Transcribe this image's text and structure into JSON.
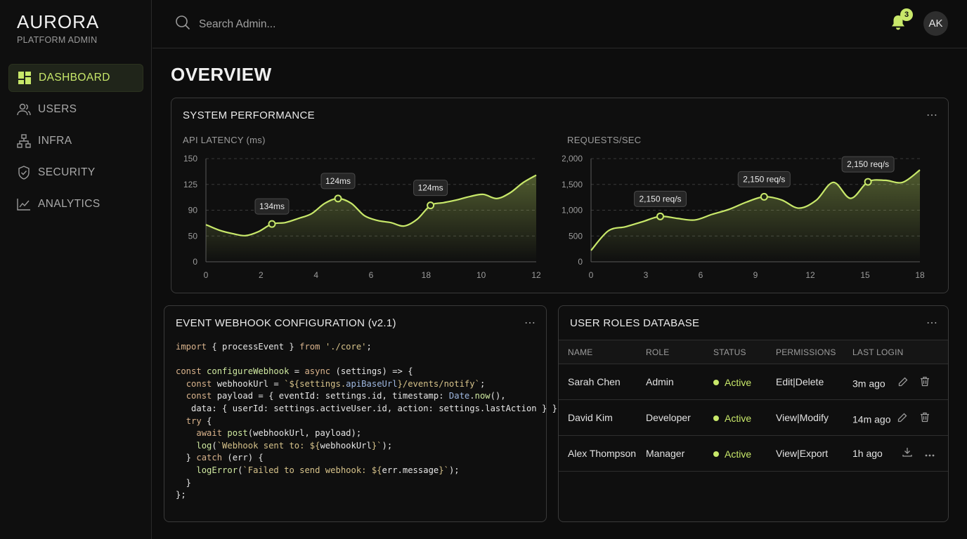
{
  "brand": {
    "name": "AURORA",
    "subtitle": "PLATFORM ADMIN"
  },
  "sidebar": {
    "items": [
      {
        "label": "DASHBOARD",
        "icon": "dashboard-icon",
        "active": true
      },
      {
        "label": "USERS",
        "icon": "users-icon",
        "active": false
      },
      {
        "label": "INFRA",
        "icon": "infra-icon",
        "active": false
      },
      {
        "label": "SECURITY",
        "icon": "shield-icon",
        "active": false
      },
      {
        "label": "ANALYTICS",
        "icon": "analytics-icon",
        "active": false
      }
    ]
  },
  "topbar": {
    "search_placeholder": "Search Admin...",
    "notifications_count": "3",
    "avatar_initials": "AK"
  },
  "page": {
    "title": "OVERVIEW"
  },
  "performance": {
    "title": "SYSTEM PERFORMANCE",
    "more": "⋯"
  },
  "chart_data": [
    {
      "type": "area",
      "title": "API LATENCY (ms)",
      "x_ticks": [
        "0",
        "2",
        "4",
        "6",
        "18",
        "10",
        "12"
      ],
      "y_ticks": [
        "150",
        "125",
        "90",
        "50",
        "0"
      ],
      "ylim": [
        0,
        150
      ],
      "grid": true,
      "values": [
        54,
        46,
        41,
        38,
        44,
        55,
        57,
        63,
        70,
        85,
        92,
        85,
        67,
        60,
        57,
        52,
        62,
        82,
        86,
        90,
        95,
        98,
        92,
        100,
        115,
        126
      ],
      "annotations": [
        {
          "label": "134ms",
          "index": 5
        },
        {
          "label": "124ms",
          "index": 10
        },
        {
          "label": "124ms",
          "index": 17
        }
      ],
      "color": "#c8e86a"
    },
    {
      "type": "area",
      "title": "REQUESTS/SEC",
      "x_ticks": [
        "0",
        "3",
        "6",
        "9",
        "12",
        "15",
        "18"
      ],
      "y_ticks": [
        "2,000",
        "1,500",
        "1,000",
        "500",
        "0"
      ],
      "ylim": [
        0,
        2000
      ],
      "grid": true,
      "values": [
        220,
        600,
        680,
        780,
        880,
        840,
        810,
        920,
        1020,
        1160,
        1260,
        1200,
        1040,
        1190,
        1540,
        1230,
        1550,
        1580,
        1540,
        1780
      ],
      "annotations": [
        {
          "label": "2,150 req/s",
          "index": 4
        },
        {
          "label": "2,150 req/s",
          "index": 10
        },
        {
          "label": "2,150 req/s",
          "index": 16
        }
      ],
      "color": "#c8e86a"
    }
  ],
  "webhook": {
    "title": "EVENT WEBHOOK CONFIGURATION (v2.1)",
    "more": "⋯"
  },
  "roles": {
    "title": "USER ROLES DATABASE",
    "more": "⋯",
    "columns": [
      "NAME",
      "ROLE",
      "STATUS",
      "PERMISSIONS",
      "LAST LOGIN"
    ],
    "rows": [
      {
        "name": "Sarah Chen",
        "role": "Admin",
        "status": "Active",
        "permissions": "Edit|Delete",
        "last_login": "3m ago",
        "actions": [
          "edit-icon",
          "trash-icon"
        ]
      },
      {
        "name": "David Kim",
        "role": "Developer",
        "status": "Active",
        "permissions": "View|Modify",
        "last_login": "14m ago",
        "actions": [
          "edit-icon",
          "trash-icon"
        ]
      },
      {
        "name": "Alex Thompson",
        "role": "Manager",
        "status": "Active",
        "permissions": "View|Export",
        "last_login": "1h ago",
        "actions": [
          "download-icon",
          "more-icon"
        ]
      }
    ]
  }
}
